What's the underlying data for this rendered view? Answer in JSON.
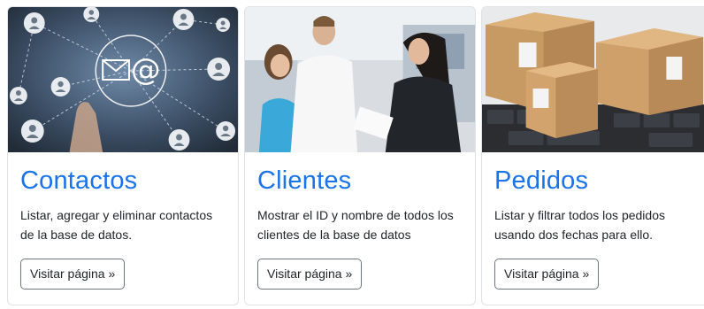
{
  "cards": [
    {
      "image": "network-contacts-photo",
      "title": "Contactos",
      "text": "Listar, agregar y eliminar contactos de la base de datos.",
      "button_label": "Visitar página »"
    },
    {
      "image": "clients-shopping-photo",
      "title": "Clientes",
      "text": "Mostrar el ID y nombre de todos los clientes de la base de datos",
      "button_label": "Visitar página »"
    },
    {
      "image": "parcel-boxes-photo",
      "title": "Pedidos",
      "text": "Listar y filtrar todos los pedidos usando dos fechas para ello.",
      "button_label": "Visitar página »"
    }
  ],
  "colors": {
    "title": "#1a73e8",
    "button_border": "#6c757d",
    "card_border": "#dfe3e7"
  }
}
